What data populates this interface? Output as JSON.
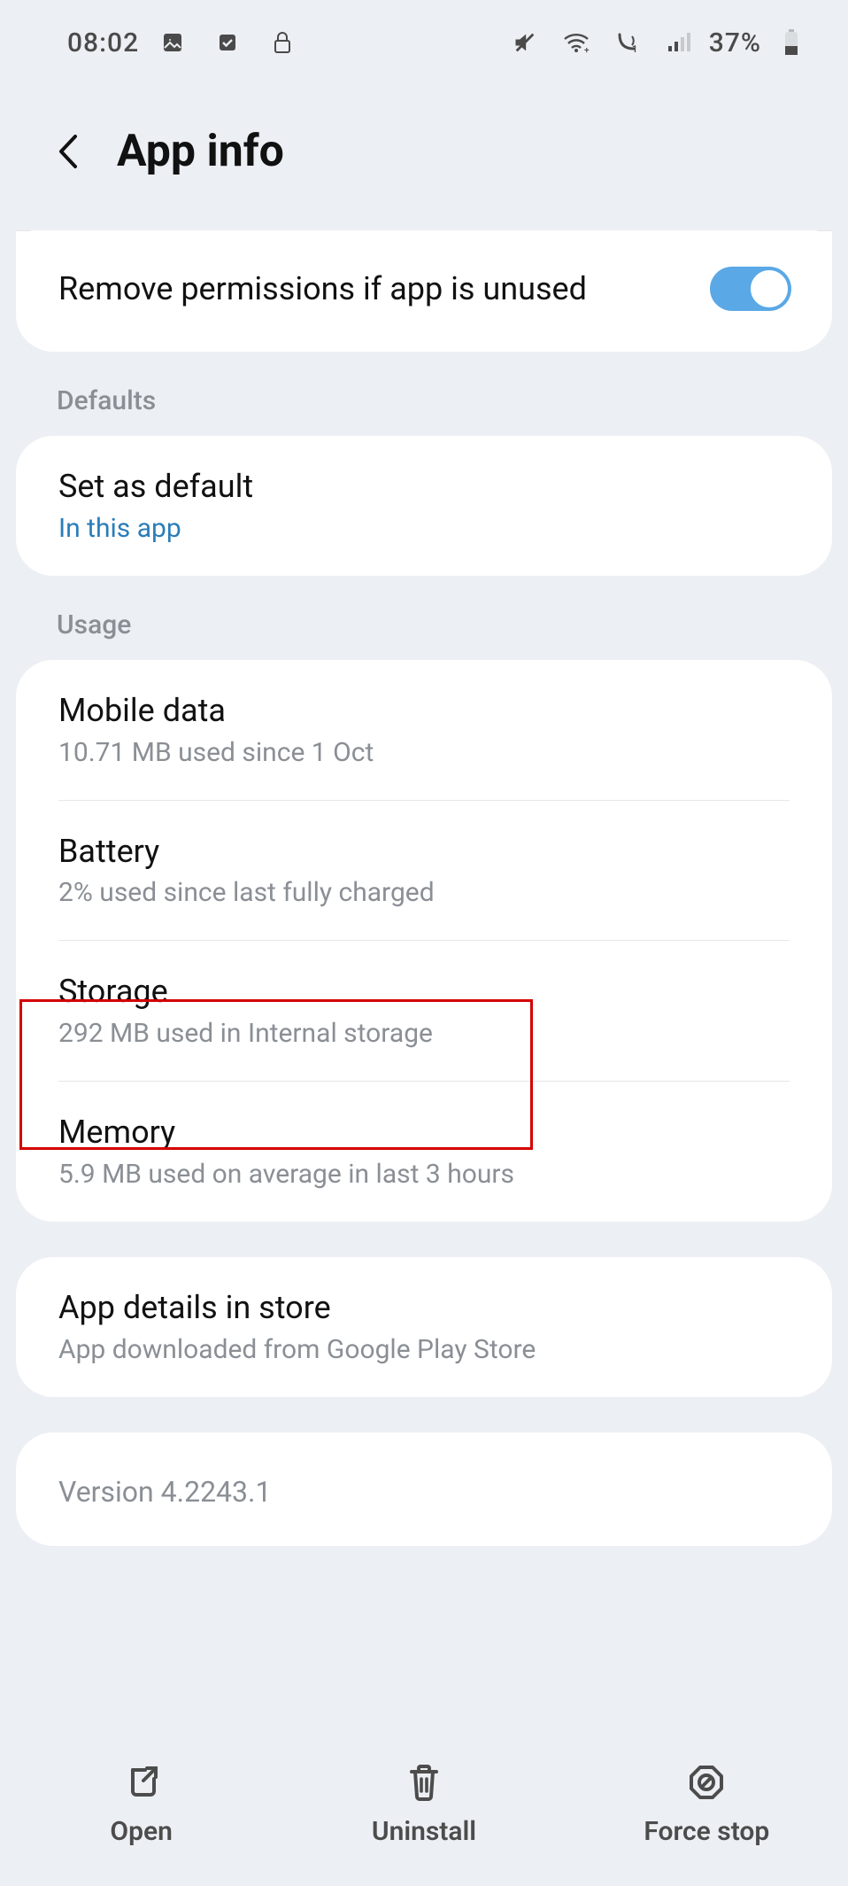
{
  "statusbar": {
    "time": "08:02",
    "battery_pct": "37%"
  },
  "header": {
    "title": "App info"
  },
  "remove_perms": {
    "label": "Remove permissions if app is unused",
    "on": true
  },
  "sections": {
    "defaults_label": "Defaults",
    "usage_label": "Usage"
  },
  "defaults": {
    "set_default_title": "Set as default",
    "set_default_sub": "In this app"
  },
  "usage": {
    "mobile_data_title": "Mobile data",
    "mobile_data_sub": "10.71 MB used since 1 Oct",
    "battery_title": "Battery",
    "battery_sub": "2% used since last fully charged",
    "storage_title": "Storage",
    "storage_sub": "292 MB used in Internal storage",
    "memory_title": "Memory",
    "memory_sub": "5.9 MB used on average in last 3 hours"
  },
  "store": {
    "title": "App details in store",
    "sub": "App downloaded from Google Play Store"
  },
  "version": {
    "text": "Version 4.2243.1"
  },
  "bottom": {
    "open": "Open",
    "uninstall": "Uninstall",
    "force_stop": "Force stop"
  }
}
